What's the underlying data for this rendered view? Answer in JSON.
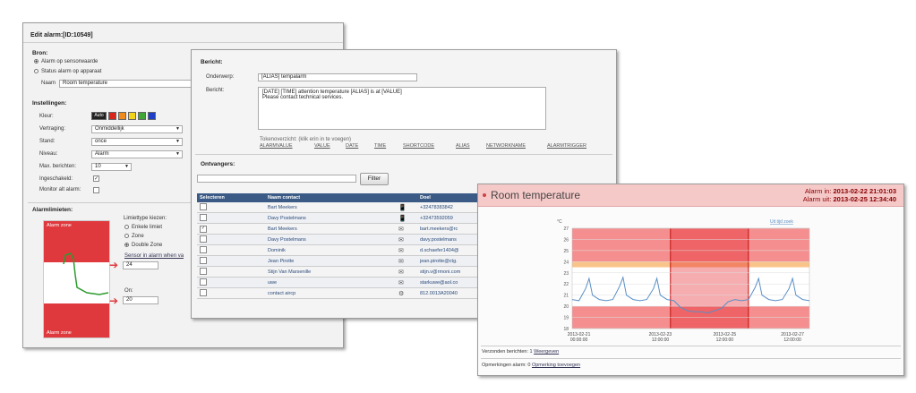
{
  "edit_alarm": {
    "title": "Edit alarm:[ID:10549]",
    "source_label": "Bron:",
    "source_options": [
      "Alarm op sensorwaarde",
      "Status alarm op apparaat"
    ],
    "name_label": "Naam",
    "name_value": "Room temperature",
    "settings_label": "Instellingen:",
    "color_label": "Kleur:",
    "color_auto": "Auto",
    "swatch_colors": [
      "#d9261c",
      "#ef8a1b",
      "#f3d21a",
      "#3fa535",
      "#1d3fc9"
    ],
    "delay_label": "Vertraging:",
    "delay_value": "Onmiddellijk",
    "state_label": "Stand:",
    "state_value": "once",
    "level_label": "Niveau:",
    "level_value": "Alarm",
    "max_msg_label": "Max. berichten:",
    "max_msg_value": "10",
    "enabled_label": "Ingeschakeld:",
    "monitor_label": "Monitor alt alarm:",
    "limits_label": "Alarmlimieten:",
    "limit_type_label": "Limiettype kiezen:",
    "limit_options": [
      "Enkele limiet",
      "Zone",
      "Double Zone"
    ],
    "alarm_zone_top": "Alarm zone",
    "alarm_zone_bottom": "Alarm zone",
    "sensor_label": "Sensor in alarm when va",
    "upper_value": "24",
    "on_label": "On:",
    "lower_value": "20"
  },
  "message": {
    "section_label": "Bericht:",
    "subject_label": "Onderwerp:",
    "subject_value": "[ALIAS] tempalarm",
    "body_label": "Bericht:",
    "body_line1": "[DATE] [TIME] attention temperature [ALIAS] is at [VALUE]",
    "body_line2": "Please contact technical services.",
    "tokens_label": "Tokenoverzicht: (klik erin in te voegen)",
    "tokens": [
      "ALARMVALUE",
      "VALUE",
      "DATE",
      "TIME",
      "SHORTCODE",
      "ALIAS",
      "NETWORKNAME",
      "ALARMTRIGGER"
    ],
    "recipients_label": "Ontvangers:",
    "filter_button": "Filter",
    "col_select": "Selecteren",
    "col_name": "Naam contact",
    "col_target": "Doel",
    "rows": [
      {
        "name": "Bart Meekers",
        "icon": "phone",
        "target": "+32478383842",
        "checked": false
      },
      {
        "name": "Davy Postelmans",
        "icon": "phone",
        "target": "+32473592059",
        "checked": false
      },
      {
        "name": "Bart Meekers",
        "icon": "mail",
        "target": "bart.meekers@rc",
        "checked": true
      },
      {
        "name": "Davy Postelmans",
        "icon": "mail",
        "target": "davy.postelmans",
        "checked": false
      },
      {
        "name": "Dominik",
        "icon": "mail",
        "target": "d.schaefer1404@",
        "checked": false
      },
      {
        "name": "Jean Pirotte",
        "icon": "mail",
        "target": "jean.pirotte@ctg.",
        "checked": false
      },
      {
        "name": "Stijn Van Marsenille",
        "icon": "mail",
        "target": "stijn.v@rmoni.com",
        "checked": false
      },
      {
        "name": "uwe",
        "icon": "mail",
        "target": "starkuwe@aol.co",
        "checked": false
      },
      {
        "name": "contact aircp",
        "icon": "gear",
        "target": "812.0013A20040",
        "checked": false
      }
    ]
  },
  "room": {
    "title": "Room temperature",
    "alarm_in_label": "Alarm in:",
    "alarm_in": "2013-02-22 21:01:03",
    "alarm_out_label": "Alarm uit:",
    "alarm_out": "2013-02-25 12:34:40",
    "unit_label": "°C",
    "legend_text": "Uit tijd zoek",
    "sent_text": "Verzonden berichten: 1",
    "sent_link": "Weergeven",
    "remarks_text": "Opmerkingen alarm: 0",
    "remarks_link": "Opmerking toevoegen"
  },
  "chart_data": {
    "type": "line",
    "title": "Room temperature",
    "ylabel": "°C",
    "ylim": [
      18,
      27
    ],
    "yticks": [
      18,
      19,
      20,
      21,
      22,
      23,
      24,
      25,
      26,
      27
    ],
    "x_ticks": [
      "2013-02-21 00:00:00",
      "2013-02-23 12:00:00",
      "2013-02-25 12:00:00",
      "2013-02-27 12:00:00"
    ],
    "alarm_zones": [
      [
        24,
        27
      ],
      [
        18,
        20
      ]
    ],
    "warning_band": [
      23.5,
      24
    ],
    "alarm_period": [
      "2013-02-22 21:01",
      "2013-02-25 12:34"
    ],
    "series": [
      {
        "color": "#5a8fc6",
        "x": [
          0,
          0.2,
          0.4,
          0.5,
          0.6,
          0.8,
          1.0,
          1.2,
          1.4,
          1.5,
          1.6,
          1.8,
          2.0,
          2.2,
          2.4,
          2.5,
          2.6,
          2.8,
          3.0,
          3.2,
          3.4,
          3.6,
          3.8,
          4.0,
          4.2,
          4.4,
          4.6,
          4.8,
          5.0,
          5.2,
          5.4,
          5.5,
          5.6,
          5.8,
          6.0,
          6.2,
          6.4,
          6.5,
          6.6,
          6.8,
          7.0
        ],
        "values": [
          20.6,
          20.5,
          21.6,
          22.5,
          21.0,
          20.6,
          20.5,
          20.6,
          21.8,
          22.6,
          21.0,
          20.6,
          20.5,
          20.6,
          21.6,
          22.5,
          21.0,
          20.6,
          20.5,
          19.9,
          19.6,
          19.5,
          19.5,
          19.4,
          19.6,
          19.8,
          20.4,
          20.6,
          20.5,
          20.6,
          21.7,
          22.5,
          21.0,
          20.6,
          20.5,
          20.6,
          21.6,
          22.5,
          21.0,
          20.6,
          20.5
        ]
      }
    ]
  }
}
